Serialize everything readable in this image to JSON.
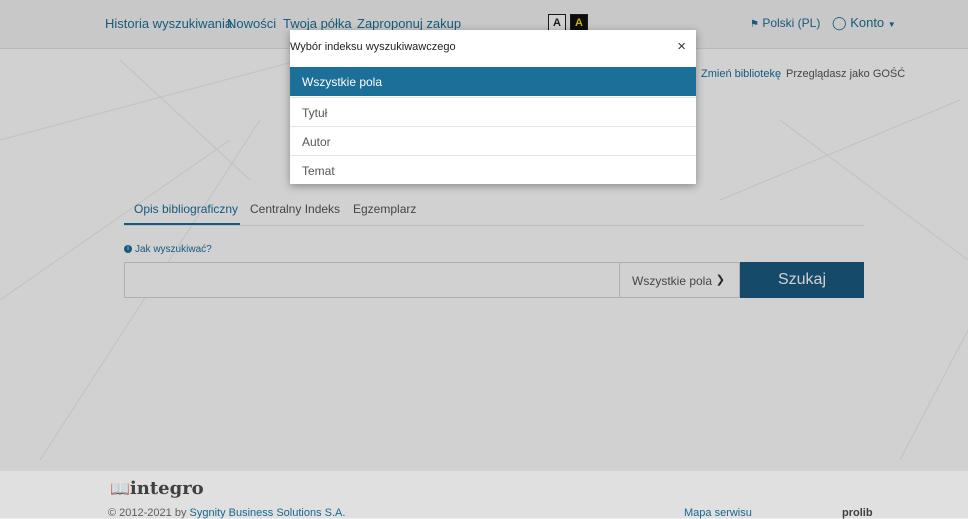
{
  "nav": {
    "links": [
      "Historia wyszukiwania",
      "Nowości",
      "Twoja półka",
      "Zaproponuj zakup"
    ],
    "contrast": [
      "A",
      "A"
    ],
    "language": "Polski (PL)",
    "account": "Konto"
  },
  "secondary": {
    "change_library": "Zmień bibliotekę",
    "guest": "Przeglądasz jako GOŚĆ"
  },
  "tabs": [
    "Opis bibliograficzny",
    "Centralny Indeks",
    "Egzemplarz"
  ],
  "search": {
    "howto": "Jak wyszukiwać?",
    "query": "",
    "field_selected": "Wszystkie pola",
    "button": "Szukaj"
  },
  "modal": {
    "title": "Wybór indeksu wyszukiwawczego",
    "close": "×",
    "options": [
      "Wszystkie pola",
      "Tytuł",
      "Autor",
      "Temat"
    ],
    "selected_index": 0
  },
  "footer": {
    "logo": "integro",
    "copyright_prefix": "© 2012-2021 by ",
    "company": "Sygnity Business Solutions S.A.",
    "sitemap": "Mapa serwisu",
    "brand": "prolib"
  },
  "colors": {
    "accent": "#1c6f98",
    "button": "#1c5b83"
  }
}
